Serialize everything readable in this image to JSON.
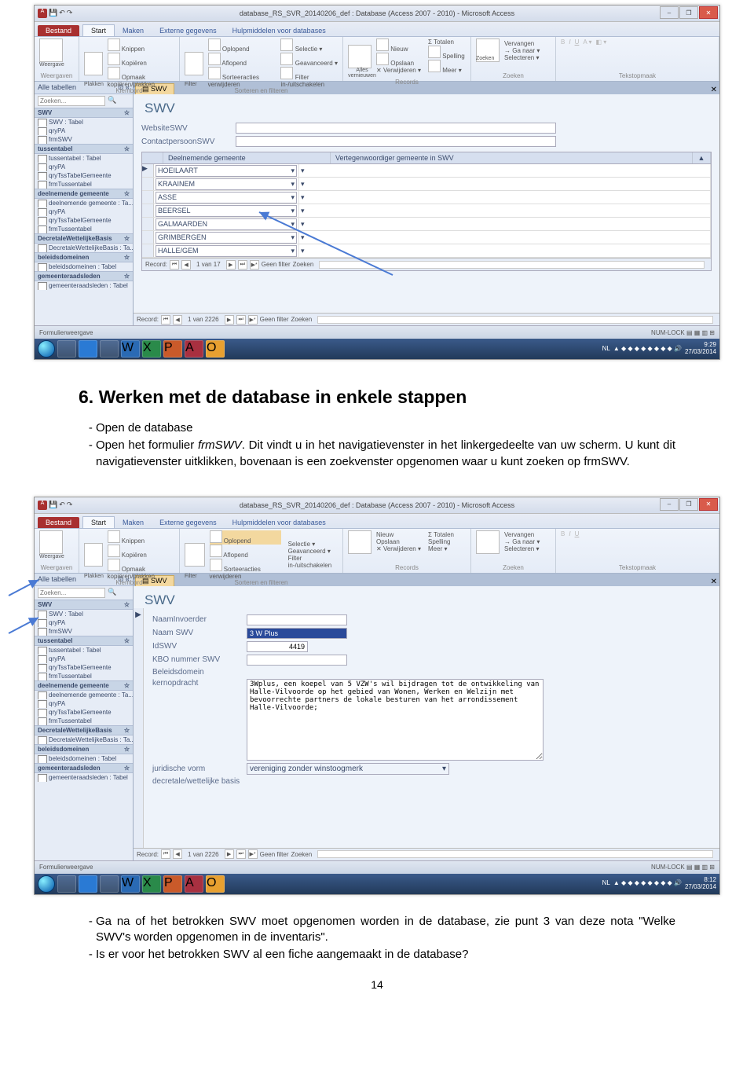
{
  "screenshots": {
    "titlebar": "database_RS_SVR_20140206_def : Database (Access 2007 - 2010) - Microsoft Access",
    "ribbon": {
      "bestand": "Bestand",
      "tabs": [
        "Start",
        "Maken",
        "Externe gegevens",
        "Hulpmiddelen voor databases"
      ],
      "group_labels": [
        "Weergaven",
        "Klembord",
        "Sorteren en filteren",
        "Records",
        "Zoeken",
        "Tekstopmaak"
      ],
      "items": {
        "weergave": "Weergave",
        "plakken": "Plakken",
        "knippen": "Knippen",
        "kopieren": "Kopiëren",
        "opmaak": "Opmaak kopiëren/plakken",
        "filter": "Filter",
        "oplopend": "Oplopend",
        "aflopend": "Aflopend",
        "sort_verw": "Sorteeracties verwijderen",
        "selectie": "Selectie",
        "geavanceerd": "Geavanceerd",
        "filter_inuit": "Filter in-/uitschakelen",
        "alles_vern": "Alles vernieuwen",
        "nieuw": "Nieuw",
        "opslaan": "Opslaan",
        "verwijderen": "Verwijderen",
        "totalen": "Totalen",
        "spelling": "Spelling",
        "meer": "Meer",
        "zoeken": "Zoeken",
        "vervangen": "Vervangen",
        "ganaar": "Ga naar",
        "selecteren": "Selecteren"
      }
    },
    "navpane": {
      "header": "Alle tabellen",
      "search_placeholder": "Zoeken...",
      "groups": [
        {
          "name": "SWV",
          "items": [
            "SWV : Tabel",
            "qryPA",
            "frmSWV"
          ]
        },
        {
          "name": "tussentabel",
          "items": [
            "tussentabel : Tabel",
            "qryPA",
            "qryTssTabelGemeente",
            "frmTussentabel"
          ]
        },
        {
          "name": "deelnemende gemeente",
          "items": [
            "deelnemende gemeente : Ta...",
            "qryPA",
            "qryTssTabelGemeente",
            "frmTussentabel"
          ]
        },
        {
          "name": "DecretaleWettelijkeBasis",
          "items": [
            "DecretaleWettelijkeBasis : Ta..."
          ]
        },
        {
          "name": "beleidsdomeinen",
          "items": [
            "beleidsdomeinen : Tabel"
          ]
        },
        {
          "name": "gemeenteraadsleden",
          "items": [
            "gemeenteraadsleden : Tabel"
          ]
        }
      ]
    },
    "doc_tab": "SWV",
    "form1": {
      "title": "SWV",
      "fields": {
        "website": "WebsiteSWV",
        "contact": "ContactpersoonSWV"
      },
      "grid": {
        "col1": "Deelnemende gemeente",
        "col2": "Vertegenwoordiger gemeente in SWV",
        "rows": [
          "HOEILAART",
          "KRAAINEM",
          "ASSE",
          "BEERSEL",
          "GALMAARDEN",
          "GRIMBERGEN",
          "HALLE/GEM"
        ]
      },
      "rec_inner": [
        "Record:",
        "1 van 17",
        "Geen filter",
        "Zoeken"
      ],
      "rec_outer": [
        "Record:",
        "1 van 2226",
        "Geen filter",
        "Zoeken"
      ]
    },
    "form2": {
      "title": "SWV",
      "fields": {
        "naaminvoerder": "NaamInvoerder",
        "naamswv": {
          "label": "Naam SWV",
          "value": "3 W Plus"
        },
        "idswv": {
          "label": "IdSWV",
          "value": "4419"
        },
        "kbo": "KBO nummer SWV",
        "beleid": "Beleidsdomein",
        "kernopdracht": {
          "label": "kernopdracht",
          "value": "3Wplus, een koepel van 5 VZW's wil bijdragen tot de ontwikkeling van Halle-Vilvoorde op het gebied van Wonen, Werken en Welzijn met bevoorrechte partners de lokale besturen van het arrondissement Halle-Vilvoorde;"
        },
        "jurvorm": {
          "label": "juridische vorm",
          "value": "vereniging zonder winstoogmerk"
        },
        "decretale": "decretale/wettelijke basis"
      },
      "rec_outer": [
        "Record:",
        "1 van 2226",
        "Geen filter",
        "Zoeken"
      ]
    },
    "statusbar": {
      "left": "Formulierweergave",
      "right": "NUM-LOCK"
    },
    "taskbar": {
      "lang": "NL",
      "time1": "9:29",
      "date1": "27/03/2014",
      "time2": "8:12",
      "date2": "27/03/2014"
    }
  },
  "document": {
    "heading": "6. Werken met de database in enkele stappen",
    "bullets1": [
      "Open de database",
      "Open het formulier frmSWV. Dit vindt u in het navigatievenster in het linkergedeelte van uw scherm. U kunt dit navigatievenster uitklikken, bovenaan is een zoekvenster opgenomen waar u kunt zoeken op frmSWV."
    ],
    "bullets2": [
      "Ga na of het betrokken SWV moet opgenomen worden in de database, zie punt 3 van deze nota \"Welke SWV's worden opgenomen in de inventaris\".",
      "Is er voor het betrokken SWV al een fiche aangemaakt in de database?"
    ],
    "italic_term": "frmSWV",
    "pagenum": "14"
  }
}
